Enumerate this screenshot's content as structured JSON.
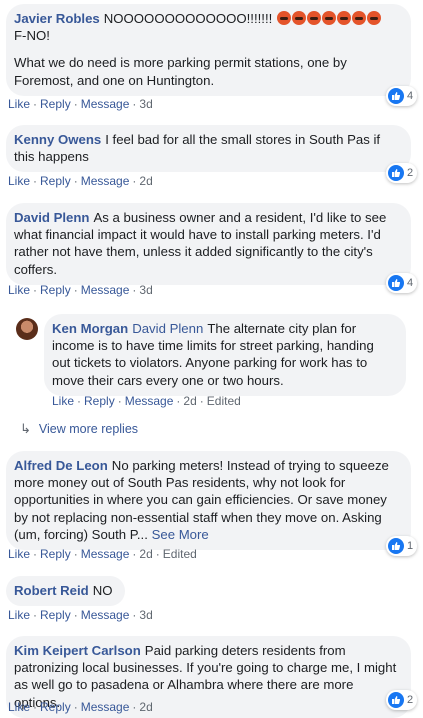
{
  "comments": [
    {
      "author": "Javier Robles",
      "mention": "",
      "text": "NOOOOOOOOOOOOO!!!!!!! ",
      "text2": "F-NO!",
      "text3": "What we do need is more parking permit stations, one by Foremost, and one on Huntington.",
      "emojis": 7,
      "actions": {
        "like": "Like",
        "reply": "Reply",
        "message": "Message",
        "time": "3d",
        "edited": ""
      },
      "reactions": "4"
    },
    {
      "author": "Kenny Owens",
      "text": "I feel bad for all the small stores in South Pas if this happens",
      "actions": {
        "like": "Like",
        "reply": "Reply",
        "message": "Message",
        "time": "2d",
        "edited": ""
      },
      "reactions": "2"
    },
    {
      "author": "David Plenn",
      "text": "As a business owner and a resident, I'd like to see what financial impact it would have to install parking meters. I'd rather not have them, unless it added significantly to the city's coffers.",
      "actions": {
        "like": "Like",
        "reply": "Reply",
        "message": "Message",
        "time": "3d",
        "edited": ""
      },
      "reactions": "4"
    },
    {
      "author": "Ken Morgan",
      "mention": "David Plenn",
      "text": "The alternate city plan for income is to have time limits for street parking, handing out tickets to violators. Anyone parking for work has to move their cars every one or two hours.",
      "actions": {
        "like": "Like",
        "reply": "Reply",
        "message": "Message",
        "time": "2d",
        "edited": "Edited"
      },
      "reactions": ""
    },
    {
      "author": "Alfred De Leon",
      "text": "No parking meters! Instead of trying to squeeze more money out of South Pas residents, why not look for opportunities in where you can gain efficiencies. Or save money by not replacing non-essential staff when they move on. Asking (um, forcing) South P...",
      "see_more": "See More",
      "actions": {
        "like": "Like",
        "reply": "Reply",
        "message": "Message",
        "time": "2d",
        "edited": "Edited"
      },
      "reactions": "1"
    },
    {
      "author": "Robert Reid",
      "text": "NO",
      "actions": {
        "like": "Like",
        "reply": "Reply",
        "message": "Message",
        "time": "3d",
        "edited": ""
      },
      "reactions": ""
    },
    {
      "author": "Kim Keipert Carlson",
      "text": "Paid parking deters residents from patronizing local businesses. If you're going to charge me, I might as well go to pasadena or Alhambra where there are more options.",
      "actions": {
        "like": "Like",
        "reply": "Reply",
        "message": "Message",
        "time": "2d",
        "edited": ""
      },
      "reactions": "2"
    }
  ],
  "view_more_replies": "View more replies",
  "colors": {
    "link": "#385898",
    "bubble": "#f2f3f5",
    "like": "#1877f2",
    "meta": "#606770"
  }
}
